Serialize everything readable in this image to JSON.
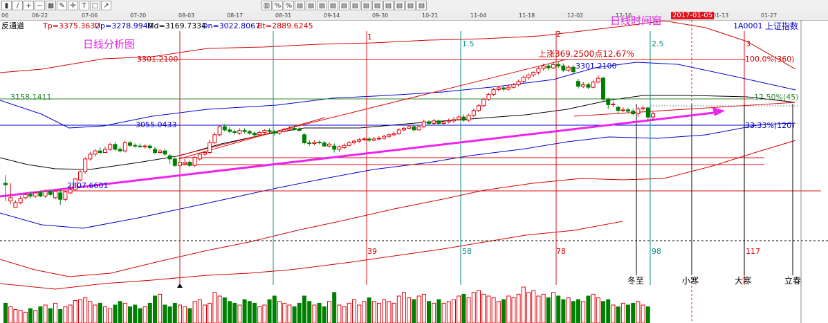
{
  "toolbar": {
    "icons": [
      "chart-bar-icon",
      "chart-line-icon",
      "zoom-in-icon",
      "zoom-out-icon",
      "grid-icon",
      "draw-icon",
      "cross-icon",
      "text-icon",
      "box-icon",
      "arrow-icon",
      "indicator-icon",
      "percent-icon",
      "percent-icon",
      "column-icon",
      "column-icon",
      "column-icon",
      "column-icon",
      "column-icon",
      "column-icon",
      "column-icon",
      "column-icon",
      "column-icon",
      "column-icon",
      "column-icon",
      "column-icon"
    ],
    "glyphs": [
      "▮",
      "/",
      "+",
      "−",
      "▦",
      "✎",
      "✛",
      "T",
      "□",
      "↗",
      "▥",
      "%",
      "%",
      "▤",
      "▤",
      "▤",
      "▤",
      "▤",
      "▤",
      "▤",
      "▤",
      "▤",
      "▤",
      "▤",
      "▤"
    ]
  },
  "indicator_line": {
    "name": "反通道",
    "tp": "Tp=3375.3632",
    "up": "Up=3278.9940",
    "md": "Md=3169.7334",
    "dn": "Dn=3022.8067",
    "bt": "Bt=2889.6245"
  },
  "security": {
    "code": "1A0001",
    "name": "上证指数"
  },
  "annotations": {
    "daily_analysis": "日线分析图",
    "daily_time_window": "日线时间窗",
    "date_badge": "2017-01-05",
    "rise_label": "上涨369.2500点12.67%",
    "fib_100": "100.0%(360)",
    "fib_1250": "12.50%(45)",
    "fib_3333": "33.33%(120)",
    "seq_labels": [
      "1",
      "1.5",
      "2",
      "2.5",
      "3"
    ],
    "count_labels": [
      "39",
      "58",
      "78",
      "98",
      "117"
    ],
    "solar_terms": [
      "冬至",
      "小寒",
      "大寒",
      "立春"
    ]
  },
  "colors": {
    "candle_up": "#e0000a",
    "candle_down": "#008000",
    "upper_band": "#d00000",
    "lower_band": "#d00000",
    "blue_band": "#0000cc",
    "mid_line": "#000000",
    "arrow": "#ee22ee",
    "red_line": "#dd1111",
    "green_line": "#2a8a2a",
    "teal_line": "#0a8a8a",
    "date_badge_bg": "#e0121a"
  },
  "chart_data": {
    "type": "candlestick",
    "x_ticks": [
      "06",
      "06-22",
      "07-06",
      "07-20",
      "08-03",
      "08-17",
      "08-31",
      "09-14",
      "09-30",
      "10-21",
      "11-04",
      "11-18",
      "12-02",
      "12-16",
      "",
      "01-13",
      "01-27"
    ],
    "price_levels": {
      "3301.2100": 3301.21,
      "3158.1411": 3158.1411,
      "3055.0433": 3055.0433,
      "2807.6601": 2807.6601
    },
    "labels": {
      "high_label": "3301.2100",
      "ma_label": "3158.1411",
      "mid_label": "3055.0433",
      "low_label": "2807.6601"
    },
    "ylim": [
      2620,
      3440
    ],
    "candles": [
      [
        2935,
        2930,
        2960,
        2880
      ],
      [
        2880,
        2890,
        2935,
        2870
      ],
      [
        2860,
        2875,
        2882,
        2860
      ],
      [
        2875,
        2888,
        2895,
        2870
      ],
      [
        2890,
        2900,
        2905,
        2885
      ],
      [
        2900,
        2895,
        2910,
        2888
      ],
      [
        2895,
        2905,
        2910,
        2890
      ],
      [
        2905,
        2895,
        2912,
        2892
      ],
      [
        2895,
        2910,
        2915,
        2890
      ],
      [
        2910,
        2900,
        2912,
        2895
      ],
      [
        2890,
        2910,
        2915,
        2885
      ],
      [
        2905,
        2885,
        2915,
        2868
      ],
      [
        2885,
        2908,
        2912,
        2880
      ],
      [
        2905,
        2915,
        2930,
        2902
      ],
      [
        2915,
        2948,
        2952,
        2912
      ],
      [
        2945,
        2970,
        2975,
        2940
      ],
      [
        2970,
        3010,
        3015,
        2965
      ],
      [
        3010,
        3025,
        3032,
        3005
      ],
      [
        3025,
        3035,
        3040,
        3018
      ],
      [
        3035,
        3030,
        3045,
        3025
      ],
      [
        3030,
        3040,
        3048,
        3028
      ],
      [
        3040,
        3055,
        3060,
        3035
      ],
      [
        3055,
        3040,
        3062,
        3035
      ],
      [
        3040,
        3035,
        3048,
        3030
      ],
      [
        3035,
        3060,
        3068,
        3030
      ],
      [
        3060,
        3052,
        3065,
        3048
      ],
      [
        3052,
        3050,
        3058,
        3045
      ],
      [
        3050,
        3048,
        3058,
        3045
      ],
      [
        3048,
        3050,
        3056,
        3042
      ],
      [
        3050,
        3045,
        3055,
        3040
      ],
      [
        3040,
        3030,
        3048,
        3025
      ],
      [
        3030,
        3035,
        3040,
        3026
      ],
      [
        3035,
        3025,
        3042,
        3020
      ],
      [
        3020,
        3010,
        3025,
        2995
      ],
      [
        3010,
        2990,
        3015,
        2985
      ],
      [
        2990,
        3000,
        3005,
        2980
      ],
      [
        2995,
        3000,
        3010,
        2990
      ],
      [
        3000,
        2990,
        3005,
        2985
      ],
      [
        2990,
        3015,
        3020,
        2985
      ],
      [
        3010,
        3025,
        3030,
        3005
      ],
      [
        3025,
        3030,
        3035,
        3020
      ],
      [
        3030,
        3060,
        3070,
        3025
      ],
      [
        3060,
        3085,
        3092,
        3055
      ],
      [
        3085,
        3110,
        3115,
        3080
      ],
      [
        3110,
        3100,
        3118,
        3095
      ],
      [
        3100,
        3095,
        3108,
        3090
      ],
      [
        3095,
        3092,
        3100,
        3085
      ],
      [
        3090,
        3098,
        3105,
        3085
      ],
      [
        3098,
        3095,
        3105,
        3090
      ],
      [
        3095,
        3090,
        3100,
        3085
      ],
      [
        3090,
        3085,
        3096,
        3080
      ],
      [
        3085,
        3092,
        3098,
        3080
      ],
      [
        3092,
        3098,
        3102,
        3088
      ],
      [
        3098,
        3095,
        3105,
        3090
      ],
      [
        3095,
        3090,
        3100,
        3082
      ],
      [
        3090,
        3095,
        3100,
        3085
      ],
      [
        3095,
        3100,
        3105,
        3092
      ],
      [
        3100,
        3105,
        3112,
        3098
      ],
      [
        3105,
        3102,
        3110,
        3098
      ],
      [
        3102,
        3098,
        3108,
        3095
      ],
      [
        3085,
        3060,
        3090,
        3055
      ],
      [
        3060,
        3058,
        3068,
        3050
      ],
      [
        3058,
        3062,
        3068,
        3052
      ],
      [
        3062,
        3060,
        3068,
        3055
      ],
      [
        3060,
        3050,
        3065,
        3048
      ],
      [
        3050,
        3056,
        3062,
        3045
      ],
      [
        3050,
        3040,
        3058,
        3030
      ],
      [
        3040,
        3048,
        3052,
        3032
      ],
      [
        3045,
        3052,
        3058,
        3040
      ],
      [
        3052,
        3060,
        3065,
        3048
      ],
      [
        3060,
        3065,
        3070,
        3055
      ],
      [
        3065,
        3070,
        3075,
        3060
      ],
      [
        3070,
        3072,
        3078,
        3065
      ],
      [
        3072,
        3068,
        3078,
        3062
      ],
      [
        3068,
        3072,
        3078,
        3065
      ],
      [
        3072,
        3074,
        3080,
        3068
      ],
      [
        3074,
        3080,
        3085,
        3070
      ],
      [
        3080,
        3085,
        3090,
        3075
      ],
      [
        3085,
        3088,
        3095,
        3080
      ],
      [
        3088,
        3100,
        3105,
        3085
      ],
      [
        3100,
        3105,
        3110,
        3096
      ],
      [
        3105,
        3110,
        3115,
        3102
      ],
      [
        3110,
        3100,
        3115,
        3095
      ],
      [
        3100,
        3110,
        3115,
        3098
      ],
      [
        3110,
        3125,
        3132,
        3105
      ],
      [
        3125,
        3120,
        3130,
        3115
      ],
      [
        3120,
        3128,
        3134,
        3115
      ],
      [
        3128,
        3120,
        3132,
        3115
      ],
      [
        3120,
        3125,
        3130,
        3115
      ],
      [
        3125,
        3128,
        3135,
        3120
      ],
      [
        3128,
        3132,
        3140,
        3122
      ],
      [
        3132,
        3140,
        3146,
        3128
      ],
      [
        3140,
        3130,
        3148,
        3125
      ],
      [
        3130,
        3145,
        3150,
        3125
      ],
      [
        3145,
        3160,
        3166,
        3140
      ],
      [
        3160,
        3175,
        3180,
        3155
      ],
      [
        3175,
        3195,
        3200,
        3170
      ],
      [
        3195,
        3210,
        3215,
        3190
      ],
      [
        3210,
        3225,
        3230,
        3205
      ],
      [
        3225,
        3230,
        3236,
        3220
      ],
      [
        3230,
        3226,
        3238,
        3220
      ],
      [
        3226,
        3232,
        3240,
        3222
      ],
      [
        3232,
        3240,
        3245,
        3228
      ],
      [
        3240,
        3250,
        3256,
        3235
      ],
      [
        3250,
        3262,
        3268,
        3245
      ],
      [
        3262,
        3270,
        3275,
        3255
      ],
      [
        3270,
        3278,
        3282,
        3264
      ],
      [
        3278,
        3290,
        3296,
        3272
      ],
      [
        3290,
        3298,
        3305,
        3284
      ],
      [
        3298,
        3292,
        3305,
        3285
      ],
      [
        3292,
        3302,
        3310,
        3288
      ],
      [
        3302,
        3298,
        3310,
        3292
      ],
      [
        3298,
        3285,
        3305,
        3280
      ],
      [
        3285,
        3294,
        3300,
        3280
      ],
      [
        3294,
        3280,
        3300,
        3272
      ],
      [
        3250,
        3235,
        3258,
        3228
      ],
      [
        3235,
        3240,
        3248,
        3230
      ],
      [
        3240,
        3232,
        3246,
        3226
      ],
      [
        3232,
        3248,
        3255,
        3228
      ],
      [
        3248,
        3260,
        3268,
        3244
      ],
      [
        3260,
        3195,
        3265,
        3190
      ],
      [
        3195,
        3178,
        3200,
        3165
      ],
      [
        3178,
        3180,
        3188,
        3170
      ],
      [
        3170,
        3160,
        3175,
        3150
      ],
      [
        3160,
        3162,
        3170,
        3155
      ],
      [
        3162,
        3158,
        3168,
        3152
      ],
      [
        3158,
        3150,
        3165,
        3145
      ],
      [
        3150,
        3165,
        3170,
        3140
      ],
      [
        3165,
        3168,
        3175,
        3160
      ],
      [
        3168,
        3140,
        3172,
        3132
      ],
      [
        3140,
        3150,
        3155,
        3130
      ]
    ],
    "volumes": [
      22,
      18,
      15,
      14,
      12,
      16,
      14,
      18,
      20,
      16,
      22,
      15,
      18,
      20,
      25,
      26,
      28,
      24,
      20,
      22,
      18,
      16,
      20,
      24,
      22,
      18,
      20,
      16,
      18,
      22,
      30,
      32,
      20,
      18,
      22,
      20,
      18,
      16,
      24,
      26,
      20,
      22,
      34,
      30,
      28,
      24,
      22,
      20,
      26,
      24,
      22,
      18,
      20,
      26,
      30,
      24,
      22,
      20,
      18,
      22,
      30,
      24,
      20,
      22,
      18,
      24,
      34,
      20,
      18,
      22,
      26,
      20,
      24,
      28,
      24,
      22,
      26,
      24,
      22,
      30,
      34,
      28,
      26,
      30,
      32,
      24,
      22,
      26,
      22,
      24,
      26,
      30,
      32,
      28,
      34,
      36,
      32,
      30,
      28,
      24,
      26,
      30,
      28,
      32,
      40,
      34,
      36,
      30,
      32,
      28,
      34,
      30,
      26,
      28,
      24,
      26,
      24,
      30,
      32,
      28,
      24,
      26,
      20,
      18,
      22,
      20,
      22,
      24,
      20,
      18
    ]
  }
}
